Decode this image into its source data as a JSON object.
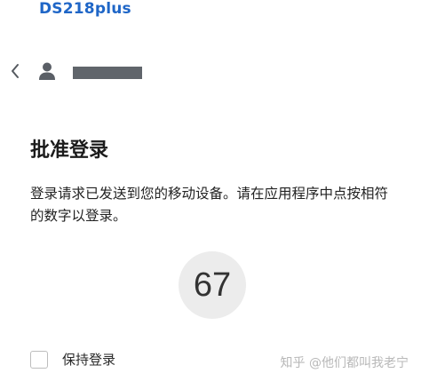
{
  "header": {
    "brand": "DS218plus"
  },
  "user": {
    "back_icon": "chevron-left-icon",
    "avatar_icon": "user-icon",
    "name_redacted": true
  },
  "main": {
    "title": "批准登录",
    "description": "登录请求已发送到您的移动设备。请在应用程序中点按相符的数字以登录。",
    "code": "67"
  },
  "keep_signed_in": {
    "label": "保持登录",
    "checked": false
  },
  "watermark": {
    "text": "知乎 @他们都叫我老宁"
  },
  "colors": {
    "brand": "#1f66c7",
    "redaction": "#60656b",
    "code_bg": "#ececec"
  }
}
